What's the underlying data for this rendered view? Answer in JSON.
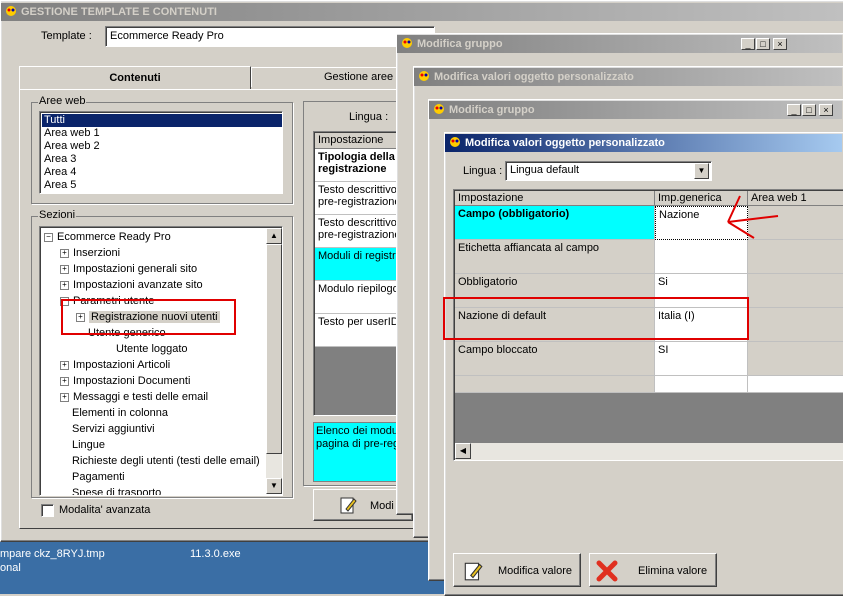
{
  "main_window": {
    "title": "GESTIONE TEMPLATE E CONTENUTI",
    "template_label": "Template :",
    "template_value": "Ecommerce Ready Pro",
    "tabs": [
      "Contenuti",
      "Gestione aree"
    ],
    "aree_web": {
      "label": "Aree web",
      "items": [
        "Tutti",
        "Area web 1",
        "Area web 2",
        "Area 3",
        "Area 4",
        "Area 5"
      ]
    },
    "sezioni": {
      "label": "Sezioni",
      "items": [
        "Ecommerce Ready Pro",
        "Inserzioni",
        "Impostazioni generali sito",
        "Impostazioni avanzate sito",
        "Parametri utente",
        "Registrazione nuovi utenti",
        "Utente generico",
        "Utente loggato",
        "Impostazioni Articoli",
        "Impostazioni Documenti",
        "Messaggi e testi delle email",
        "Elementi in colonna",
        "Servizi aggiuntivi",
        "Lingue",
        "Richieste degli utenti (testi delle email)",
        "Pagamenti",
        "Spese di trasporto"
      ]
    },
    "modalita_avanzata": "Modalita' avanzata",
    "lingua_label": "Lingua :",
    "impostazione_header": "Impostazione",
    "content_rows": [
      "Tipologia della registrazione",
      "Testo descrittivo pre-registrazione",
      "Testo descrittivo pre-registrazione",
      "Moduli di registra",
      "Modulo riepilogo",
      "Testo per userID"
    ],
    "description_text": "Elenco dei moduli pagina di pre-regis",
    "modifica_button": "Modi"
  },
  "dialogs": {
    "modifica_gruppo_1": "Modifica gruppo",
    "modifica_valori_1": "Modifica valori oggetto personalizzato",
    "modifica_gruppo_2": "Modifica gruppo",
    "modifica_valori_front": {
      "title": "Modifica valori oggetto personalizzato",
      "lingua_label": "Lingua :",
      "lingua_value": "Lingua default",
      "columns": [
        "Impostazione",
        "Imp.generica",
        "Area web 1"
      ],
      "rows": [
        {
          "name": "Campo (obbligatorio)",
          "value": "Nazione"
        },
        {
          "name": "Etichetta affiancata al campo",
          "value": ""
        },
        {
          "name": "Obbligatorio",
          "value": "Si"
        },
        {
          "name": "Nazione di default",
          "value": "Italia (I)"
        },
        {
          "name": "Campo bloccato",
          "value": "SI"
        }
      ],
      "modifica_valore": "Modifica valore",
      "elimina_valore": "Elimina valore"
    }
  },
  "taskbar": {
    "items": [
      "mpare",
      "ckz_8RYJ.tmp",
      "11.3.0.exe",
      "onal"
    ]
  },
  "colors": {
    "selection": "#0a246a",
    "cyan": "#00ffff",
    "highlight_red": "#e00000",
    "desktop": "#3a6ea5"
  }
}
